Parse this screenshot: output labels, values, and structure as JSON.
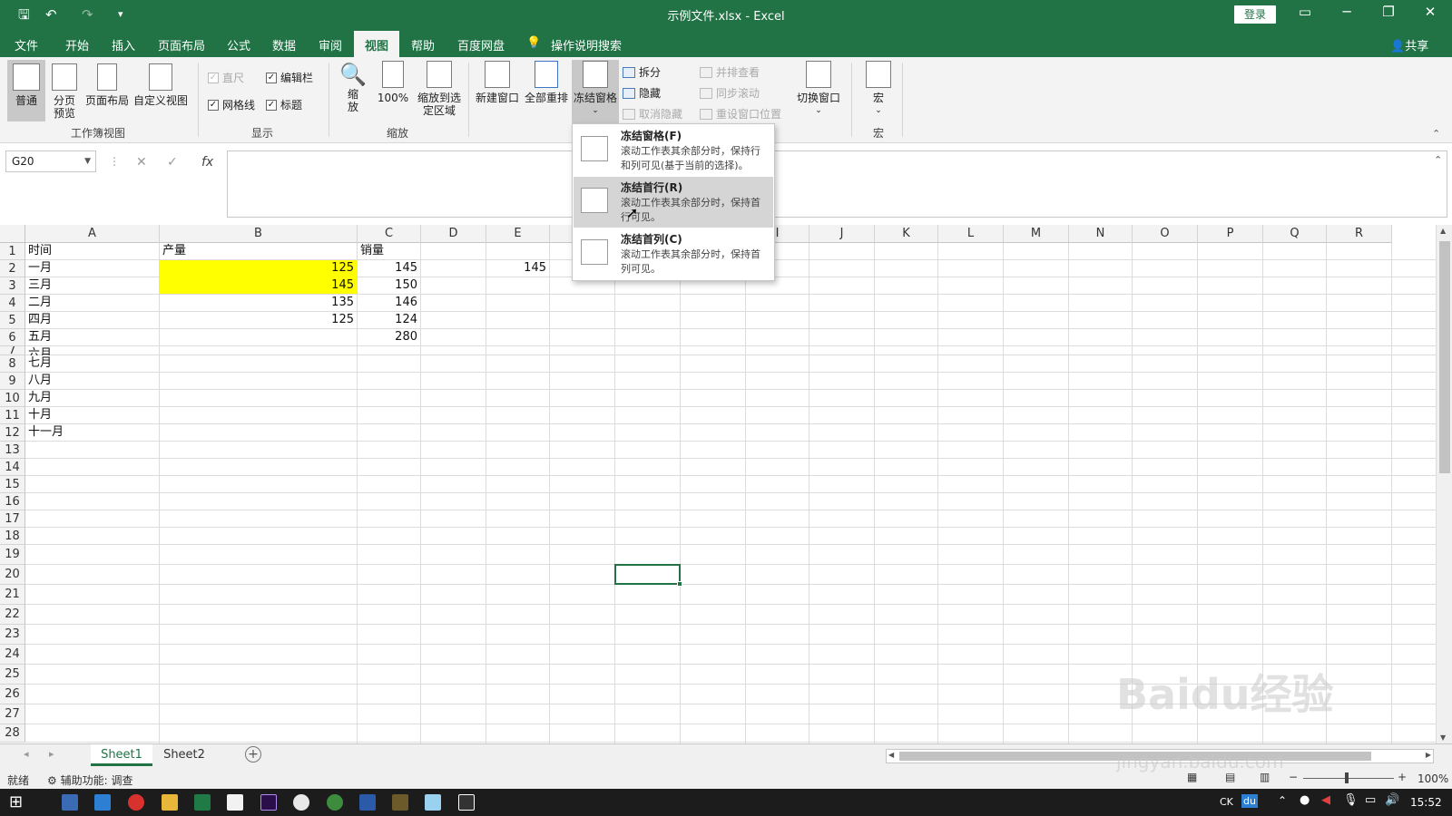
{
  "titlebar": {
    "title": "示例文件.xlsx  -  Excel",
    "login": "登录",
    "undo": "↶",
    "redo": "↷"
  },
  "menu": {
    "tabs": [
      "文件",
      "开始",
      "插入",
      "页面布局",
      "公式",
      "数据",
      "审阅",
      "视图",
      "帮助",
      "百度网盘",
      "操作说明搜索"
    ],
    "active_tab": "视图",
    "share": "共享"
  },
  "ribbon": {
    "workbook_views": {
      "label": "工作簿视图",
      "normal": "普通",
      "page_break": "分页预览",
      "page_layout": "页面布局",
      "custom": "自定义视图"
    },
    "show": {
      "label": "显示",
      "ruler": "直尺",
      "formula_bar": "编辑栏",
      "gridlines": "网格线",
      "headings": "标题"
    },
    "zoom": {
      "label": "缩放",
      "zoom": "缩放",
      "zoom100": "100%",
      "zoom_sel": "缩放到选定区域"
    },
    "window": {
      "new_window": "新建窗口",
      "arrange_all": "全部重排",
      "freeze_panes": "冻结窗格",
      "split": "拆分",
      "hide": "隐藏",
      "unhide": "取消隐藏",
      "side_by_side": "并排查看",
      "sync_scroll": "同步滚动",
      "reset_pos": "重设窗口位置",
      "switch": "切换窗口"
    },
    "macros": {
      "label": "宏",
      "macros": "宏"
    }
  },
  "formula_bar": {
    "name_box": "G20",
    "cancel": "✕",
    "enter": "✓",
    "fx": "fx",
    "formula": ""
  },
  "freeze_menu": {
    "items": [
      {
        "title": "冻结窗格(F)",
        "desc": "滚动工作表其余部分时，保持行和列可见(基于当前的选择)。"
      },
      {
        "title": "冻结首行(R)",
        "desc": "滚动工作表其余部分时，保持首行可见。"
      },
      {
        "title": "冻结首列(C)",
        "desc": "滚动工作表其余部分时，保持首列可见。"
      }
    ],
    "hovered_index": 1
  },
  "sheet": {
    "columns": [
      "A",
      "B",
      "C",
      "D",
      "E",
      "F",
      "G",
      "H",
      "I",
      "J",
      "K",
      "L",
      "M",
      "N",
      "O",
      "P",
      "Q",
      "R"
    ],
    "rows": [
      "1",
      "2",
      "3",
      "4",
      "5",
      "6",
      "7",
      "8",
      "9",
      "10",
      "11",
      "12",
      "13",
      "14",
      "15",
      "16",
      "17",
      "18",
      "19",
      "20",
      "21",
      "22",
      "23",
      "24",
      "25",
      "26",
      "27",
      "28"
    ],
    "selected_cell": "G20",
    "highlight_fill": "#ffff00",
    "cells": {
      "A1": "时间",
      "B1": "产量",
      "C1": "销量",
      "A2": "一月",
      "B2": "125",
      "C2": "145",
      "E2": "145",
      "A3": "三月",
      "B3": "145",
      "C3": "150",
      "A4": "二月",
      "B4": "135",
      "C4": "146",
      "A5": "四月",
      "B5": "125",
      "C5": "124",
      "A6": "五月",
      "C6": "280",
      "A7": "六月",
      "A8": "七月",
      "A9": "八月",
      "A10": "九月",
      "A11": "十月",
      "A12": "十一月"
    }
  },
  "sheet_tabs": {
    "tabs": [
      "Sheet1",
      "Sheet2"
    ],
    "active": "Sheet1",
    "add": "+"
  },
  "status": {
    "ready": "就绪",
    "accessibility": "辅助功能: 调查",
    "zoom": "100%"
  },
  "taskbar": {
    "lang": "CK",
    "ime": "du",
    "time": "15:52"
  },
  "watermark": {
    "brand": "Baidu经验",
    "url": "jingyan.baidu.com"
  },
  "colors": {
    "excel_green": "#217346",
    "highlight": "#ffff00",
    "selection": "#217346"
  }
}
